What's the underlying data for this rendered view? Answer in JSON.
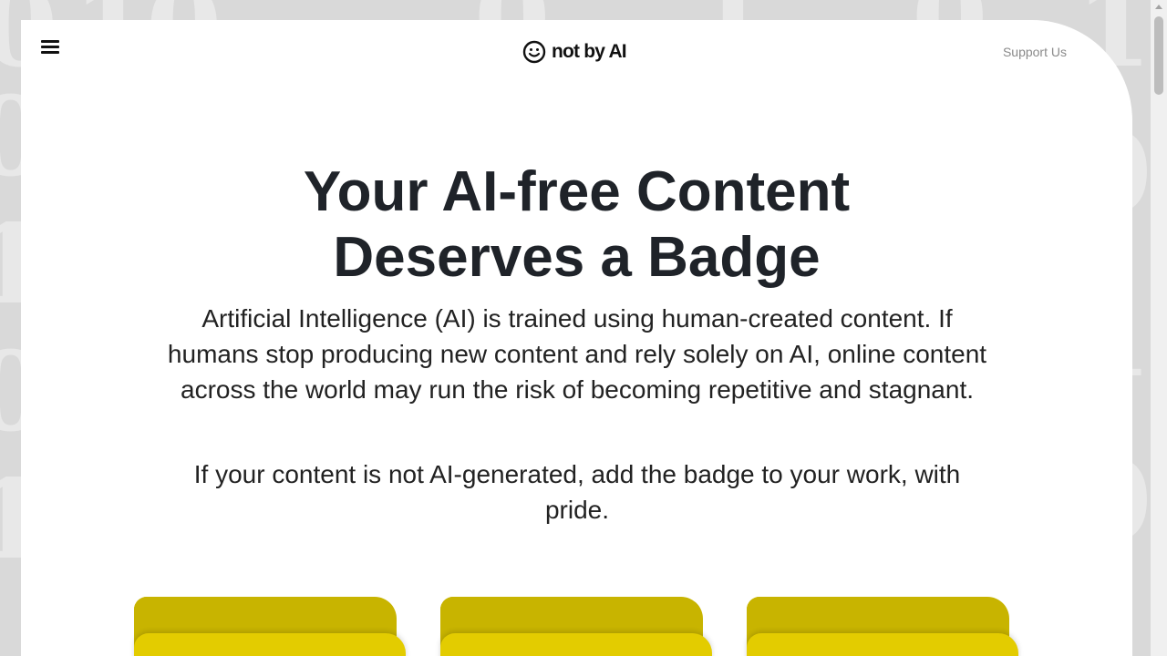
{
  "header": {
    "logo_text": "not by AI",
    "support_label": "Support Us"
  },
  "hero": {
    "title_line1": "Your AI-free Content",
    "title_line2": "Deserves a Badge",
    "intro": "Artificial Intelligence (AI) is trained using human-created content. If humans stop producing new content and rely solely on AI, online content across the world may run the risk of becoming repetitive and stagnant.",
    "pride": "If your content is not AI-generated, add the badge to your work, with pride."
  },
  "icons": {
    "menu": "hamburger-menu-icon",
    "logo": "smiley-face-icon"
  },
  "colors": {
    "folder_back": "#c8b400",
    "folder_front": "#e3cc00",
    "text": "#1f2329",
    "support": "#8a8a8a"
  }
}
